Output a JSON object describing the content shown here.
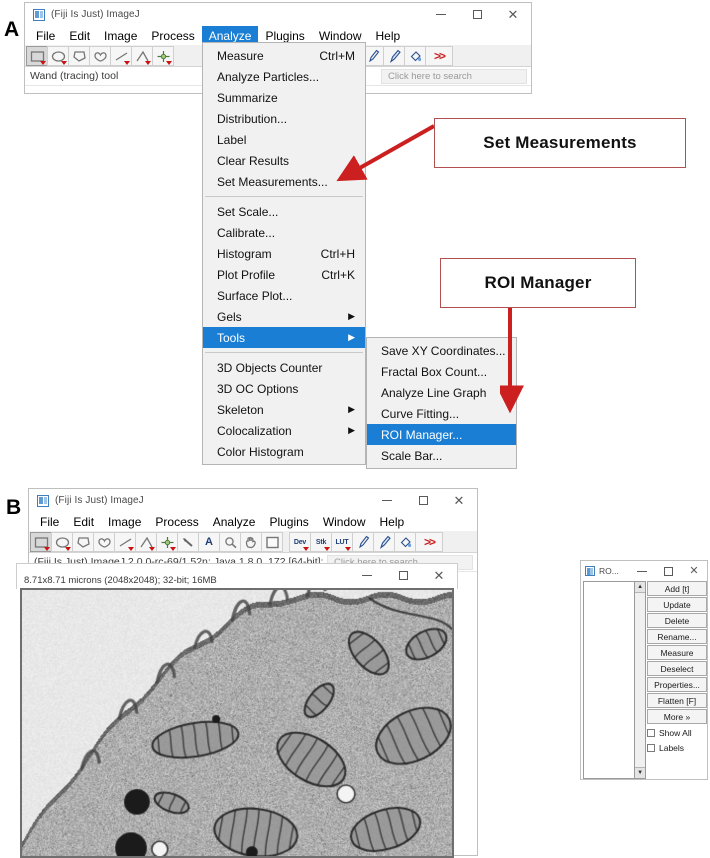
{
  "panels": {
    "a_label": "A",
    "b_label": "B"
  },
  "window_a": {
    "title": "(Fiji Is Just) ImageJ",
    "icon": "imagej-logo-icon",
    "controls": {
      "minimize": "minimize-icon",
      "maximize": "maximize-icon",
      "close": "close-icon"
    },
    "menubar": [
      {
        "label": "File",
        "active": false
      },
      {
        "label": "Edit",
        "active": false
      },
      {
        "label": "Image",
        "active": false
      },
      {
        "label": "Process",
        "active": false
      },
      {
        "label": "Analyze",
        "active": true
      },
      {
        "label": "Plugins",
        "active": false
      },
      {
        "label": "Window",
        "active": false
      },
      {
        "label": "Help",
        "active": false
      }
    ],
    "toolbar_icons": [
      "rectangle-tool-icon",
      "oval-tool-icon",
      "polygon-tool-icon",
      "freehand-tool-icon",
      "straight-line-tool-icon",
      "angle-tool-icon",
      "point-tool-icon"
    ],
    "toolbar_icons_right": [
      "dev-tool-icon",
      "lut-tool-icon",
      "pencil-tool-icon",
      "brush-tool-icon",
      "flood-fill-tool-icon",
      "more-tools-icon"
    ],
    "status_text": "Wand (tracing) tool",
    "search_placeholder": "Click here to search"
  },
  "menu_analyze": {
    "items": [
      {
        "label": "Measure",
        "accel": "Ctrl+M",
        "submenu": false,
        "highlight": false,
        "separator_after": false
      },
      {
        "label": "Analyze Particles...",
        "accel": "",
        "submenu": false,
        "highlight": false,
        "separator_after": false
      },
      {
        "label": "Summarize",
        "accel": "",
        "submenu": false,
        "highlight": false,
        "separator_after": false
      },
      {
        "label": "Distribution...",
        "accel": "",
        "submenu": false,
        "highlight": false,
        "separator_after": false
      },
      {
        "label": "Label",
        "accel": "",
        "submenu": false,
        "highlight": false,
        "separator_after": false
      },
      {
        "label": "Clear Results",
        "accel": "",
        "submenu": false,
        "highlight": false,
        "separator_after": false
      },
      {
        "label": "Set Measurements...",
        "accel": "",
        "submenu": false,
        "highlight": false,
        "separator_after": true
      },
      {
        "label": "Set Scale...",
        "accel": "",
        "submenu": false,
        "highlight": false,
        "separator_after": false
      },
      {
        "label": "Calibrate...",
        "accel": "",
        "submenu": false,
        "highlight": false,
        "separator_after": false
      },
      {
        "label": "Histogram",
        "accel": "Ctrl+H",
        "submenu": false,
        "highlight": false,
        "separator_after": false
      },
      {
        "label": "Plot Profile",
        "accel": "Ctrl+K",
        "submenu": false,
        "highlight": false,
        "separator_after": false
      },
      {
        "label": "Surface Plot...",
        "accel": "",
        "submenu": false,
        "highlight": false,
        "separator_after": false
      },
      {
        "label": "Gels",
        "accel": "",
        "submenu": true,
        "highlight": false,
        "separator_after": false
      },
      {
        "label": "Tools",
        "accel": "",
        "submenu": true,
        "highlight": true,
        "separator_after": true
      },
      {
        "label": "3D Objects Counter",
        "accel": "",
        "submenu": false,
        "highlight": false,
        "separator_after": false
      },
      {
        "label": "3D OC Options",
        "accel": "",
        "submenu": false,
        "highlight": false,
        "separator_after": false
      },
      {
        "label": "Skeleton",
        "accel": "",
        "submenu": true,
        "highlight": false,
        "separator_after": false
      },
      {
        "label": "Colocalization",
        "accel": "",
        "submenu": true,
        "highlight": false,
        "separator_after": false
      },
      {
        "label": "Color Histogram",
        "accel": "",
        "submenu": false,
        "highlight": false,
        "separator_after": false
      }
    ]
  },
  "menu_tools": {
    "items": [
      {
        "label": "Save XY Coordinates...",
        "highlight": false
      },
      {
        "label": "Fractal Box Count...",
        "highlight": false
      },
      {
        "label": "Analyze Line Graph",
        "highlight": false
      },
      {
        "label": "Curve Fitting...",
        "highlight": false
      },
      {
        "label": "ROI Manager...",
        "highlight": true
      },
      {
        "label": "Scale Bar...",
        "highlight": false
      }
    ]
  },
  "callouts": [
    {
      "label": "Set Measurements",
      "name": "callout-set-measurements"
    },
    {
      "label": "ROI Manager",
      "name": "callout-roi-manager"
    }
  ],
  "window_b": {
    "title": "(Fiji Is Just) ImageJ",
    "icon": "imagej-logo-icon",
    "menubar": [
      {
        "label": "File"
      },
      {
        "label": "Edit"
      },
      {
        "label": "Image"
      },
      {
        "label": "Process"
      },
      {
        "label": "Analyze"
      },
      {
        "label": "Plugins"
      },
      {
        "label": "Window"
      },
      {
        "label": "Help"
      }
    ],
    "toolbar_icons": [
      "rectangle-tool-icon",
      "oval-tool-icon",
      "polygon-tool-icon",
      "freehand-tool-icon",
      "straight-line-tool-icon",
      "angle-tool-icon",
      "point-tool-icon",
      "wand-tool-icon",
      "text-tool-icon",
      "magnifier-tool-icon",
      "hand-tool-icon",
      "color-picker-tool-icon"
    ],
    "toolbar_icons_right": [
      "dev-tool-icon",
      "stk-tool-icon",
      "lut-tool-icon",
      "pencil-tool-icon",
      "brush-tool-icon",
      "flood-fill-tool-icon",
      "more-tools-icon"
    ],
    "status_text": "(Fiji Is Just) ImageJ 2.0.0-rc-69/1.52n; Java 1.8.0_172 [64-bit];",
    "search_placeholder": "Click here to search",
    "image_info": "8.71x8.71 microns (2048x2048); 32-bit; 16MB",
    "image_alt": "transmission electron micrograph of cell edge with mitochondria"
  },
  "image_window": {
    "controls": {
      "minimize": "minimize-icon",
      "maximize": "maximize-icon",
      "close": "close-icon"
    }
  },
  "roi_manager": {
    "title": "RO...",
    "icon": "imagej-logo-icon",
    "controls": {
      "minimize": "minimize-icon",
      "maximize": "maximize-icon",
      "close": "close-icon"
    },
    "scroll_up": "scroll-up-arrow-icon",
    "scroll_down": "scroll-down-arrow-icon",
    "buttons": [
      "Add [t]",
      "Update",
      "Delete",
      "Rename...",
      "Measure",
      "Deselect",
      "Properties...",
      "Flatten [F]",
      "More »"
    ],
    "checkboxes": [
      {
        "label": "Show All",
        "checked": false
      },
      {
        "label": "Labels",
        "checked": false
      }
    ]
  },
  "colors": {
    "menu_highlight": "#1a7fd4",
    "callout_border": "#b05050",
    "arrow_red": "#cc1f1f"
  }
}
